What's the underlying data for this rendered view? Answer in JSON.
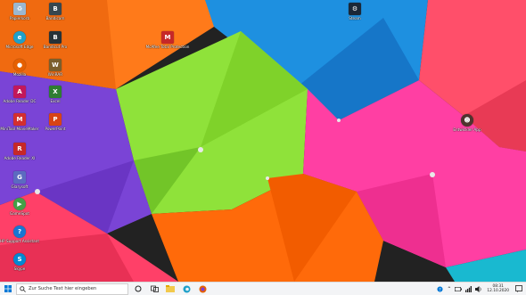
{
  "desktop": {
    "icons": [
      {
        "label": "Papierkorb",
        "glyph": "recycle-bin-icon",
        "color": "#9bb7d0"
      },
      {
        "label": "Microsoft Edge",
        "glyph": "edge-icon",
        "color": "#1fa0c9"
      },
      {
        "label": "Mozilla",
        "glyph": "firefox-icon",
        "color": "#e66000"
      },
      {
        "label": "Adobe Reader DC",
        "glyph": "acrobat-icon",
        "color": "#c2185b"
      },
      {
        "label": "MiniTool MovieMaker",
        "glyph": "moviemaker-icon",
        "color": "#d32f2f"
      },
      {
        "label": "Adobe Reader XI",
        "glyph": "reader-icon",
        "color": "#c62828"
      },
      {
        "label": "Glarysoft",
        "glyph": "glary-icon",
        "color": "#5c6bc0"
      },
      {
        "label": "GameSpot",
        "glyph": "gamespot-icon",
        "color": "#43a047"
      },
      {
        "label": "HP Support Assistant",
        "glyph": "help-icon",
        "color": "#1976d2"
      },
      {
        "label": "Skype",
        "glyph": "skype-icon",
        "color": "#0288d1"
      },
      {
        "label": "Bandicam",
        "glyph": "bandicam-icon",
        "color": "#37474f"
      },
      {
        "label": "Bandicut Pro",
        "glyph": "bandicut-icon",
        "color": "#263238"
      },
      {
        "label": "WinRAR",
        "glyph": "winrar-icon",
        "color": "#7b5e2c"
      },
      {
        "label": "Excel",
        "glyph": "excel-icon",
        "color": "#2e7d32"
      },
      {
        "label": "PowerPoint",
        "glyph": "pptx-icon",
        "color": "#d84315"
      },
      {
        "label": "McAfee Total Protection",
        "glyph": "mcafee-icon",
        "color": "#c62828"
      },
      {
        "label": "Steam",
        "glyph": "steam-icon",
        "color": "#1b2838"
      },
      {
        "label": "Entwickler App",
        "glyph": "dev-icon",
        "color": "#4e342e"
      }
    ]
  },
  "taskbar": {
    "search_placeholder": "Zur Suche Text hier eingeben",
    "pinned": [
      {
        "name": "task-view-icon"
      },
      {
        "name": "widgets-icon"
      },
      {
        "name": "file-explorer-icon"
      },
      {
        "name": "edge-icon"
      },
      {
        "name": "store-icon"
      }
    ],
    "tray": {
      "time": "08:31",
      "date": "12.10.2020"
    }
  },
  "colors": {
    "taskbar_bg": "#f3f4f6",
    "accent": "#0078d7"
  }
}
